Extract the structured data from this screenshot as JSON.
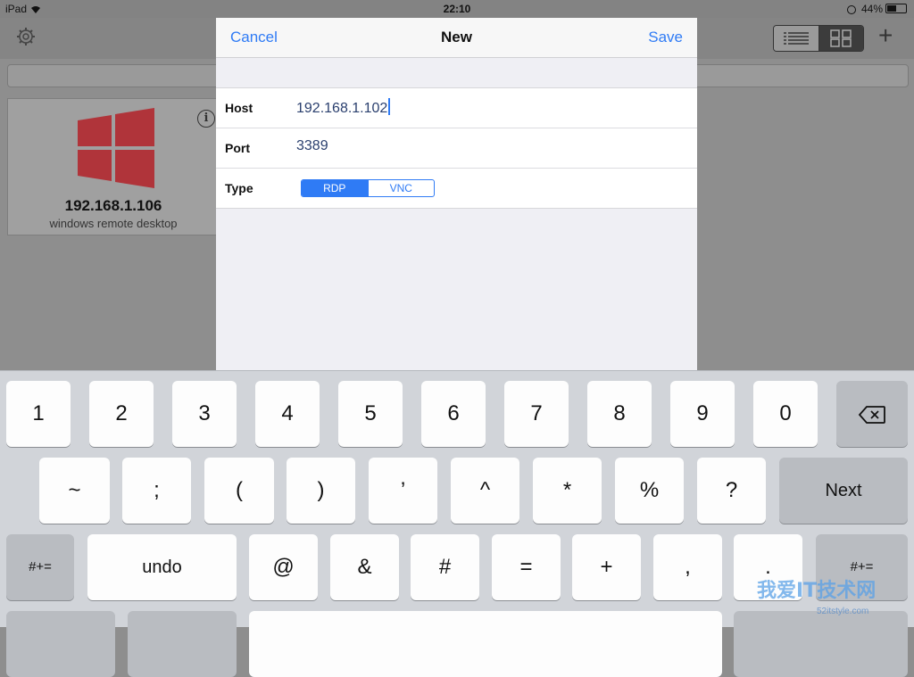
{
  "status_bar": {
    "device": "iPad",
    "time": "22:10",
    "battery": "44%"
  },
  "background": {
    "card": {
      "host": "192.168.1.106",
      "subtitle": "windows remote desktop",
      "info_glyph": "i"
    },
    "plus_glyph": "+"
  },
  "modal": {
    "cancel_label": "Cancel",
    "title": "New",
    "save_label": "Save",
    "fields": {
      "host": {
        "label": "Host",
        "value": "192.168.1.102"
      },
      "port": {
        "label": "Port",
        "value": "3389"
      },
      "type": {
        "label": "Type",
        "options": [
          "RDP",
          "VNC"
        ],
        "selected": "RDP"
      }
    }
  },
  "keyboard": {
    "row1": [
      "1",
      "2",
      "3",
      "4",
      "5",
      "6",
      "7",
      "8",
      "9",
      "0"
    ],
    "row2": [
      "~",
      ";",
      "(",
      ")",
      "’",
      "^",
      "*",
      "%",
      "?"
    ],
    "next_label": "Next",
    "row3": {
      "shift_label": "#+=",
      "undo_label": "undo",
      "keys": [
        "@",
        "&",
        "#",
        "=",
        "+",
        ",",
        "."
      ],
      "shift_label_right": "#+="
    }
  },
  "watermark": {
    "text": "我爱IT技术网",
    "url": "52itstyle.com"
  },
  "colors": {
    "accent": "#2f7bf5",
    "win_red": "#b0343a"
  }
}
